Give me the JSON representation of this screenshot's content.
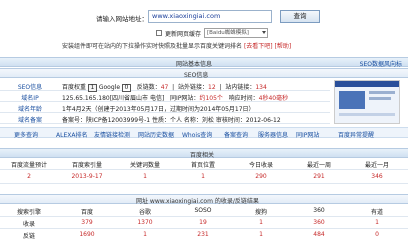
{
  "search": {
    "label": "请输入网站地址：",
    "value": "www.xiaoxingiai.com",
    "button": "查询",
    "checkbox_label": "更新网页缓存",
    "select_value": "[Baidu蜘蛛模拟]",
    "notice": "安装组件即可在站内的下拉操作实时快照及批量显示百度关键词排名",
    "notice_link": "[去看下吧]",
    "notice_help": "[帮助]"
  },
  "info_header": {
    "title": "网站基本信息",
    "right_link": "SEO数据风向标"
  },
  "seo": {
    "section_label": "SEO信息",
    "rows": [
      {
        "label": "SEO信息",
        "baidu_label": "百度权重",
        "baidu_value": "1",
        "google_label": "Google",
        "google_value": "0",
        "backlinks_label": "反链数：",
        "backlinks_value": "47",
        "outbound_label": "站外链接：",
        "outbound_value": "12",
        "inbound_label": "站内链接：",
        "inbound_value": "134"
      },
      {
        "label": "域名IP",
        "value": "125.65.165.180[四川省眉山市 电信]",
        "same_ip_label": "同IP网站：",
        "same_ip_value": "约105个",
        "speed_label": "响应时间：",
        "speed_value": "4秒40毫秒"
      },
      {
        "label": "域名年龄",
        "value": "1年4月2天（创建于2013年05月17日，过期时间为2014年05月17日）"
      },
      {
        "label": "域名备案",
        "value": "备案号：陕ICP备12003999号-1  性质：个人  名称：刘松 审核时间：2012-06-12"
      }
    ],
    "tools": [
      "更多查询",
      "ALEXA排名",
      "友情链接检测",
      "网站历史数据",
      "Whois查询",
      "备案查询",
      "服务器信息",
      "同IP网站",
      "百度异常提醒"
    ]
  },
  "baidu_related": {
    "title": "百度相关",
    "headers": [
      "百度流量预计",
      "百度索引量",
      "关键词数量",
      "首页位置",
      "今日收录",
      "最近一周",
      "最近一月"
    ],
    "values": [
      "2",
      "2013-9-17",
      "1",
      "1",
      "290",
      "291",
      "346"
    ],
    "domain_title": "网址 www.xiaoxingiai.com 的收录/反链结果",
    "engine_headers": [
      "搜索引擎",
      "百度",
      "谷歌",
      "SOSO",
      "搜狗",
      "360",
      "有道"
    ],
    "rows": [
      {
        "name": "收录",
        "values": [
          "379",
          "1370",
          "19",
          "1",
          "360",
          "1"
        ]
      },
      {
        "name": "反链",
        "values": [
          "1690",
          "1",
          "231",
          "1",
          "484",
          "0"
        ]
      }
    ]
  }
}
